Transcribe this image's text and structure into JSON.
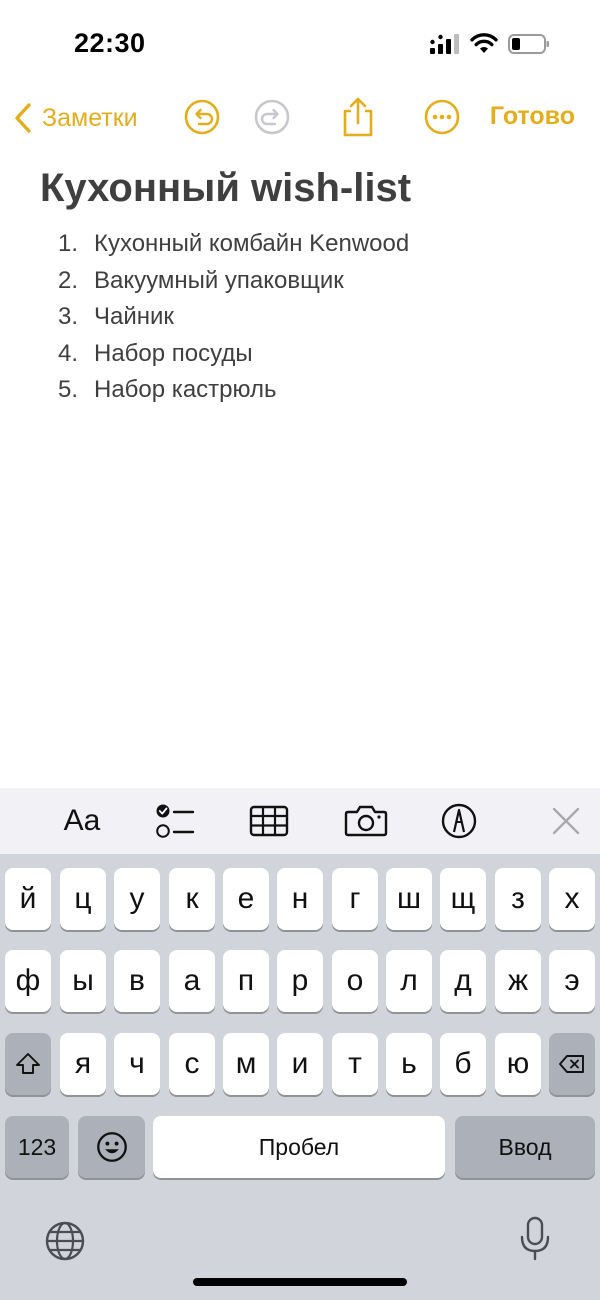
{
  "status_bar": {
    "time": "22:30"
  },
  "nav": {
    "back_label": "Заметки",
    "done_label": "Готово",
    "accent_color": "#e3ad1c",
    "icons": [
      "chevron-left-icon",
      "undo-icon",
      "redo-icon",
      "share-icon",
      "more-icon"
    ]
  },
  "note": {
    "title": "Кухонный wish-list",
    "items": [
      {
        "num": "1.",
        "text": "Кухонный комбайн Kenwood"
      },
      {
        "num": "2.",
        "text": "Вакуумный упаковщик"
      },
      {
        "num": "3.",
        "text": "Чайник"
      },
      {
        "num": "4.",
        "text": "Набор посуды"
      },
      {
        "num": "5.",
        "text": "Набор кастрюль"
      }
    ]
  },
  "keyboard_toolbar": {
    "format_label": "Aa",
    "icons": [
      "checklist-icon",
      "table-icon",
      "camera-icon",
      "markup-icon",
      "close-icon"
    ]
  },
  "keyboard": {
    "row1": [
      "й",
      "ц",
      "у",
      "к",
      "е",
      "н",
      "г",
      "ш",
      "щ",
      "з",
      "х"
    ],
    "row2": [
      "ф",
      "ы",
      "в",
      "а",
      "п",
      "р",
      "о",
      "л",
      "д",
      "ж",
      "э"
    ],
    "row3": [
      "я",
      "ч",
      "с",
      "м",
      "и",
      "т",
      "ь",
      "б",
      "ю"
    ],
    "numbers_label": "123",
    "space_label": "Пробел",
    "return_label": "Ввод"
  }
}
